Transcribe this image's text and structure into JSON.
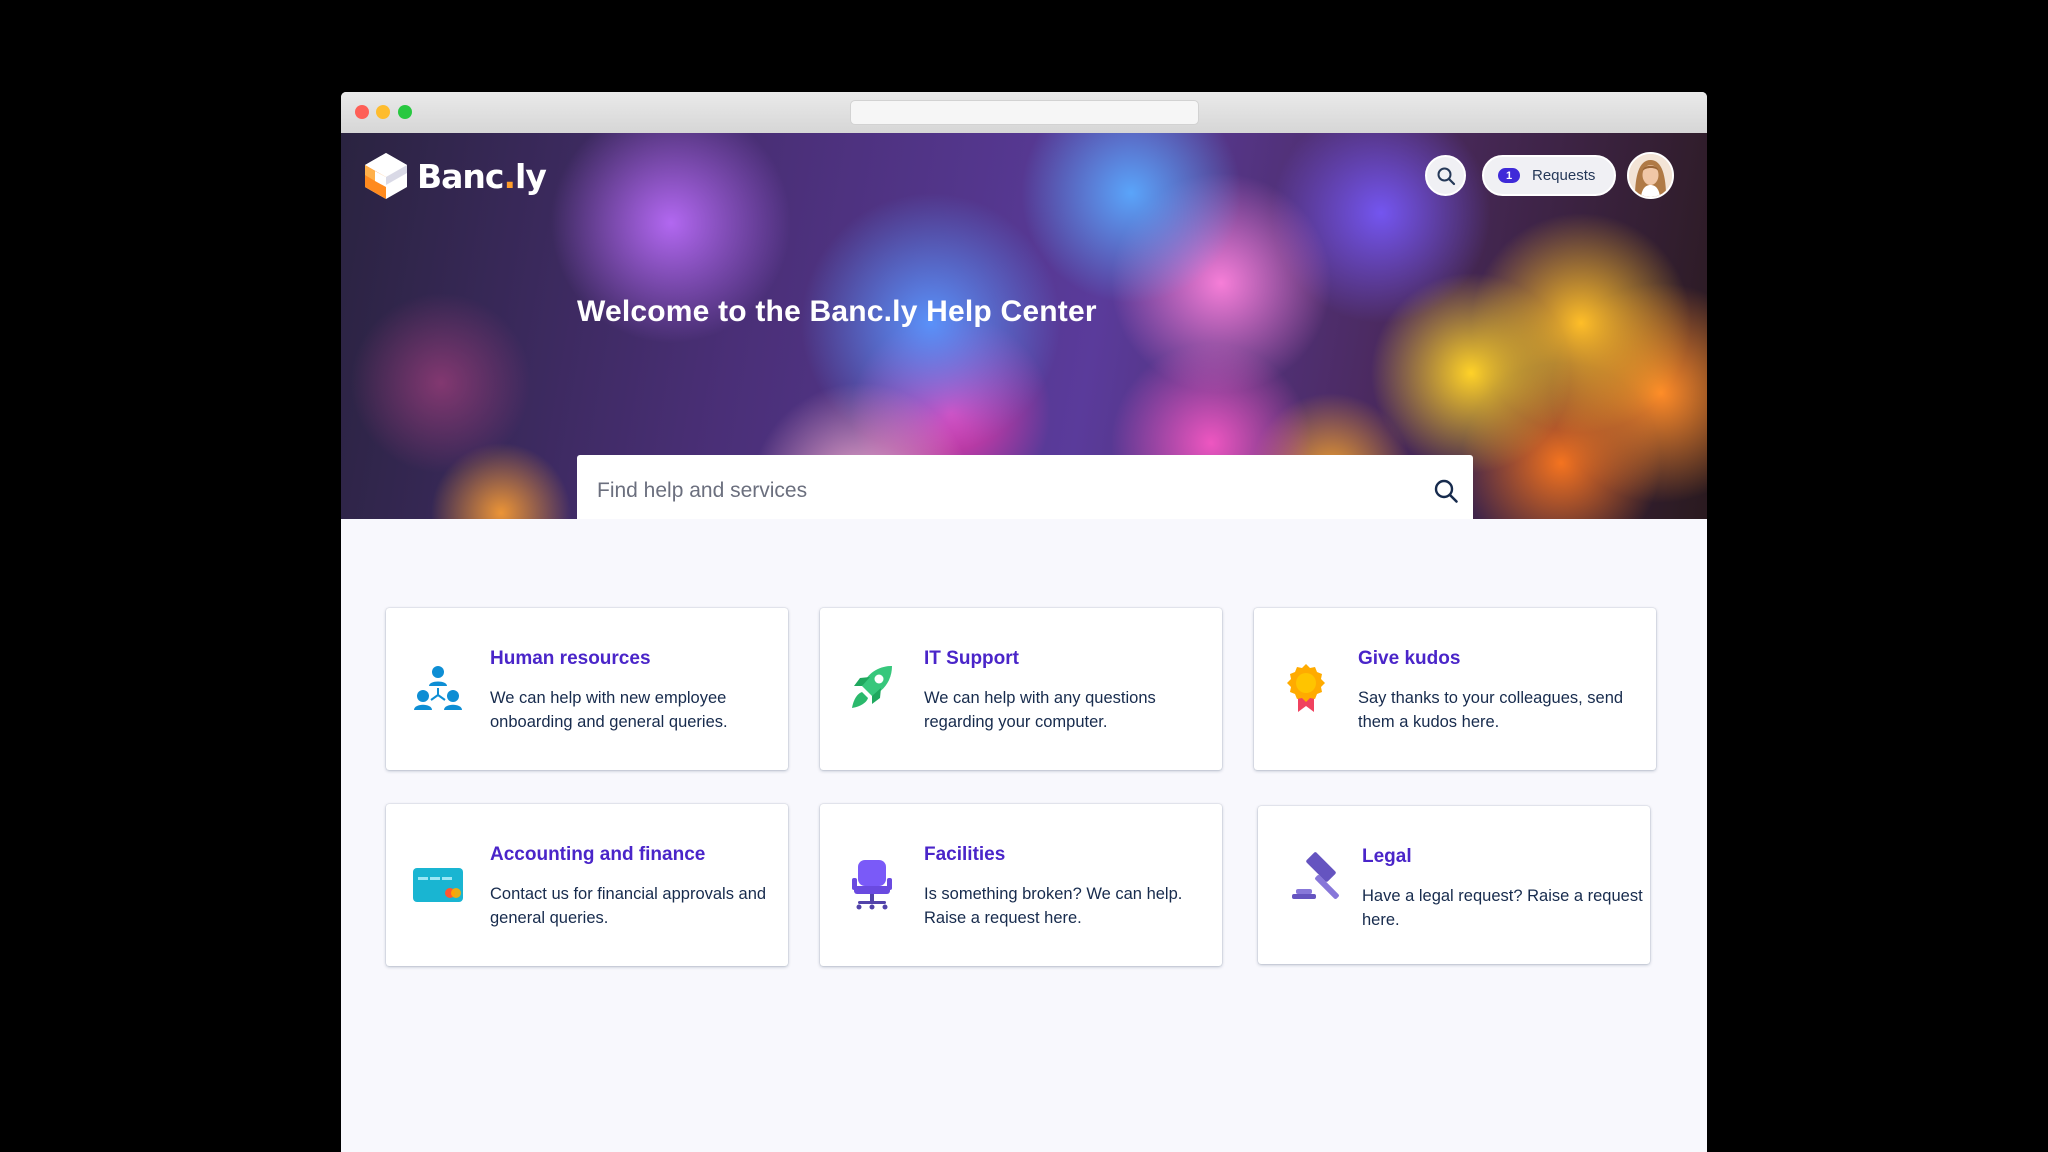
{
  "brand": {
    "name_main": "Banc",
    "name_dot": ".",
    "name_suffix": "ly",
    "accent_color": "#ff9d2a"
  },
  "header": {
    "search_icon": "search-icon",
    "requests_count": "1",
    "requests_label": "Requests",
    "avatar": "user-avatar"
  },
  "hero": {
    "title": "Welcome to the Banc.ly Help Center",
    "search_placeholder": "Find help and services",
    "search_icon": "search-icon"
  },
  "colors": {
    "card_title": "#4a25c9",
    "card_text": "#172b4d",
    "badge": "#3f2ad8"
  },
  "cards": [
    {
      "title": "Human resources",
      "description": "We can help with new employee onboarding and general queries.",
      "icon": "people-network-icon"
    },
    {
      "title": "IT Support",
      "description": "We can help with any questions regarding your computer.",
      "icon": "rocket-icon"
    },
    {
      "title": "Give kudos",
      "description": "Say thanks to your colleagues, send them a kudos here.",
      "icon": "award-ribbon-icon"
    },
    {
      "title": "Accounting and finance",
      "description": "Contact us for financial approvals and general queries.",
      "icon": "credit-card-icon"
    },
    {
      "title": "Facilities",
      "description": "Is something broken? We can help. Raise a request here.",
      "icon": "office-chair-icon"
    },
    {
      "title": "Legal",
      "description": "Have a legal request? Raise a request here.",
      "icon": "gavel-icon"
    }
  ]
}
